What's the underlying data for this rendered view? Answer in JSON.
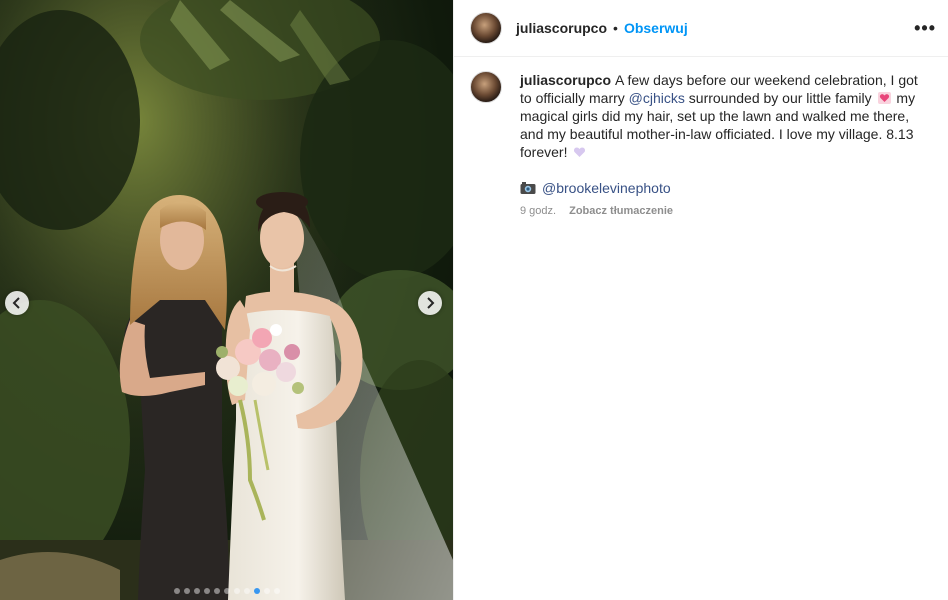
{
  "post": {
    "username": "juliascorupco",
    "separator": "•",
    "follow_label": "Obserwuj",
    "more_icon": "more-options-icon",
    "more_glyph": "•••"
  },
  "caption": {
    "username": "juliascorupco",
    "part1": "A few days before our weekend celebration, I got to officially marry ",
    "mention": "@cjhicks",
    "part2": " surrounded by our little family ",
    "part3": " my magical girls did my hair, set up the lawn and walked me there, and my beautiful mother-in-law officiated. I love my village. 8.13 forever! ",
    "emoji1": "pink-heart-emoji",
    "emoji2": "lilac-heart-emoji"
  },
  "credit": {
    "icon": "camera-icon",
    "handle": "@brookelevinephoto"
  },
  "meta": {
    "time_ago": "9 godz.",
    "translate_label": "Zobacz tłumaczenie"
  },
  "carousel": {
    "total": 11,
    "active_index": 8,
    "prev_icon": "chevron-left-icon",
    "next_icon": "chevron-right-icon"
  },
  "colors": {
    "link": "#385185",
    "follow": "#0095f6",
    "active_dot": "#3897f0",
    "muted": "#8e8e8e"
  }
}
